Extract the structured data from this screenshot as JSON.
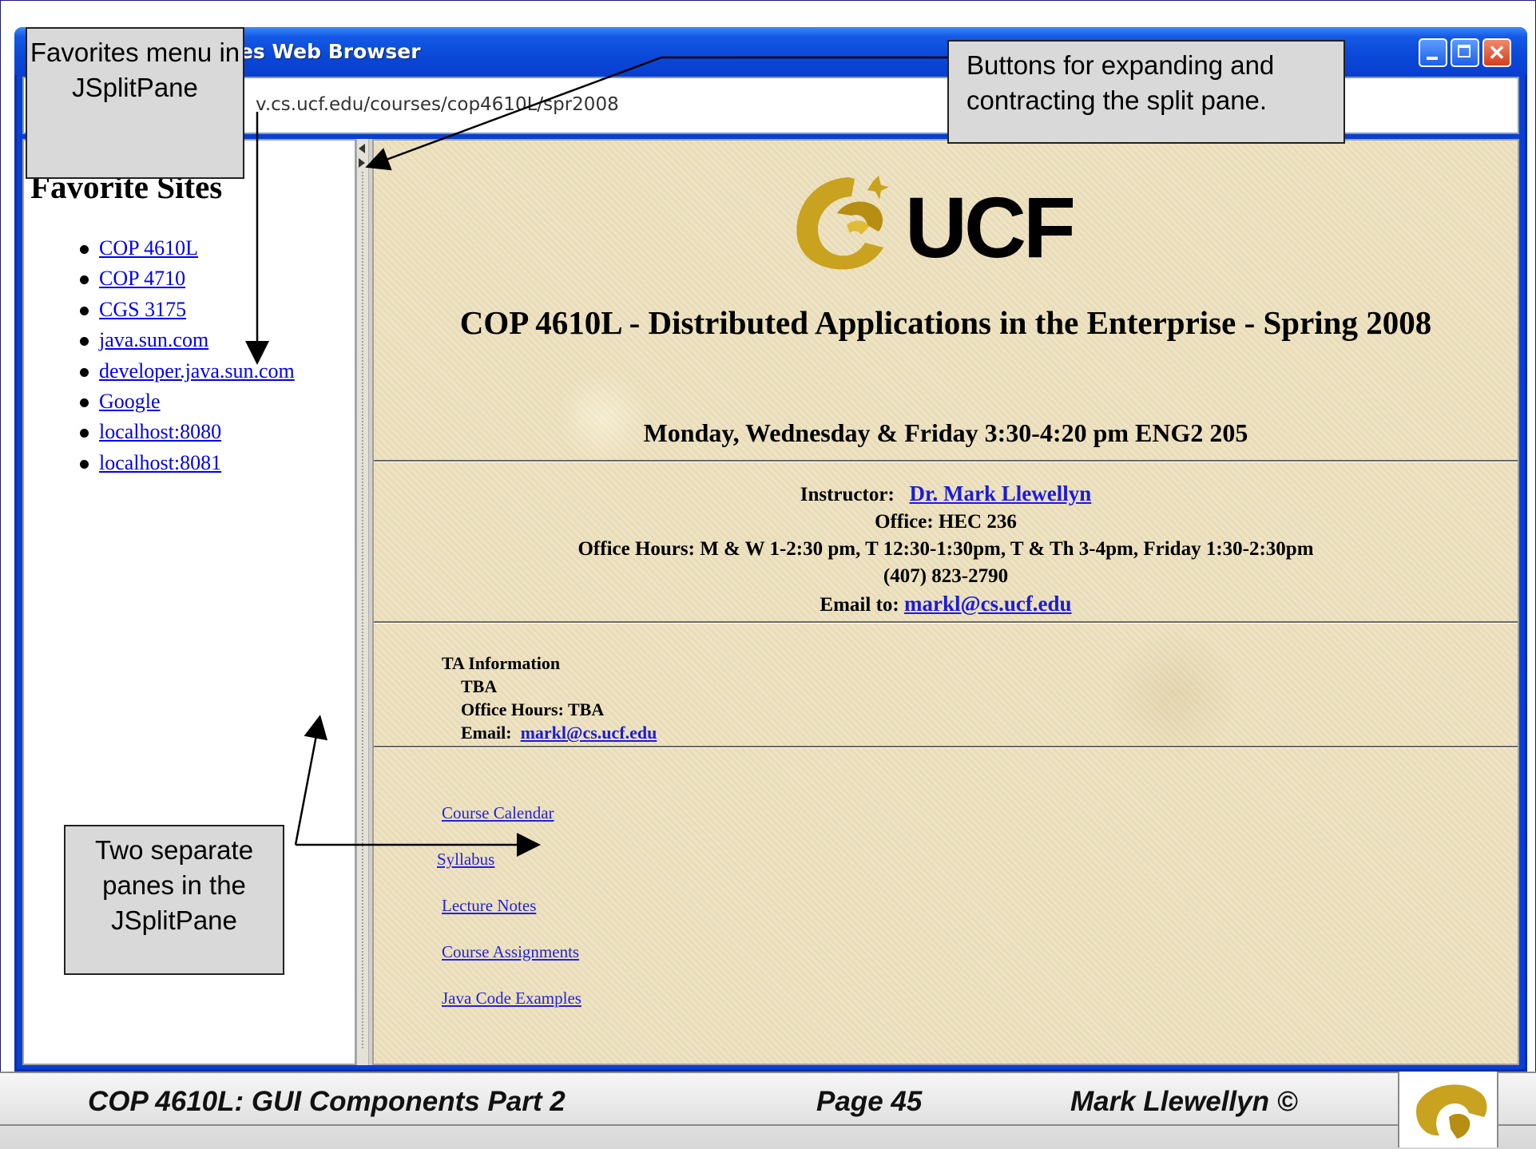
{
  "window": {
    "title": "tes Web Browser",
    "url": "v.cs.ucf.edu/courses/cop4610L/spr2008"
  },
  "left_pane": {
    "heading": "Favorite Sites",
    "items": [
      {
        "label": "COP 4610L"
      },
      {
        "label": "COP 4710"
      },
      {
        "label": "CGS 3175"
      },
      {
        "label": "java.sun.com"
      },
      {
        "label": "developer.java.sun.com"
      },
      {
        "label": "Google"
      },
      {
        "label": "localhost:8080"
      },
      {
        "label": "localhost:8081"
      }
    ]
  },
  "right_pane": {
    "logo_text": "UCF",
    "course_title": "COP 4610L - Distributed Applications in the Enterprise - Spring 2008",
    "schedule": "Monday, Wednesday & Friday 3:30-4:20 pm ENG2 205",
    "instructor_label": "Instructor:",
    "instructor_name": "Dr. Mark Llewellyn",
    "office": "Office: HEC 236",
    "office_hours": "Office Hours: M & W 1-2:30 pm, T 12:30-1:30pm, T & Th 3-4pm, Friday 1:30-2:30pm",
    "phone": "(407) 823-2790",
    "email_label": "Email to:",
    "email": "markl@cs.ucf.edu",
    "ta": {
      "heading": "TA Information",
      "name": "TBA",
      "office_hours": "Office Hours:  TBA",
      "email_label": "Email:",
      "email": "markl@cs.ucf.edu"
    },
    "links": [
      {
        "label": "Course Calendar"
      },
      {
        "label": "Syllabus"
      },
      {
        "label": "Lecture Notes"
      },
      {
        "label": "Course Assignments"
      },
      {
        "label": "Java Code Examples"
      }
    ]
  },
  "callouts": {
    "favorites": "Favorites menu in JSplitPane",
    "buttons": "Buttons for expanding and contracting the split pane.",
    "panes": "Two separate panes in the JSplitPane"
  },
  "footer": {
    "left": "COP 4610L: GUI Components Part 2",
    "center": "Page 45",
    "right": "Mark Llewellyn ©"
  }
}
